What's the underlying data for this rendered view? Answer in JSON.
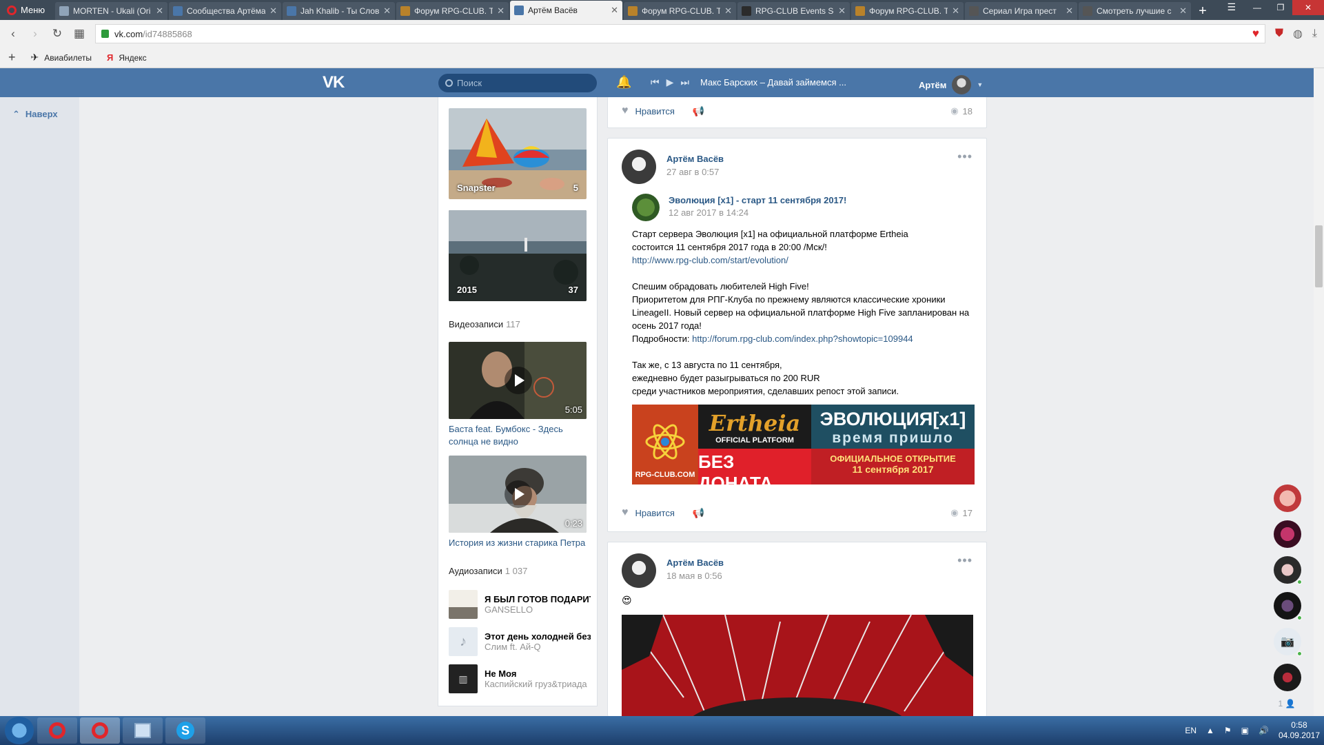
{
  "browser": {
    "menu_label": "Меню",
    "tabs": [
      {
        "label": "MORTEN - Ukali (Ori",
        "icon": "tab-favicon",
        "active": false
      },
      {
        "label": "Сообщества Артёма",
        "icon": "vk-favicon",
        "active": false
      },
      {
        "label": "Jah Khalib - Ты Слов",
        "icon": "vk-favicon",
        "active": false
      },
      {
        "label": "Форум RPG-CLUB. Т",
        "icon": "rpg-favicon",
        "active": false
      },
      {
        "label": "Артём Васёв",
        "icon": "vk-favicon",
        "active": true
      },
      {
        "label": "Форум RPG-CLUB. Т",
        "icon": "rpg-favicon",
        "active": false
      },
      {
        "label": "RPG-CLUB Events Sc",
        "icon": "dark-favicon",
        "active": false
      },
      {
        "label": "Форум RPG-CLUB. Т",
        "icon": "rpg-favicon",
        "active": false
      },
      {
        "label": "Сериал Игра прест",
        "icon": "film-favicon",
        "active": false
      },
      {
        "label": "Смотреть лучшие с",
        "icon": "film-favicon",
        "active": false
      }
    ],
    "url_host": "vk.com",
    "url_path": "/id74885868",
    "bookmarks": [
      {
        "label": "Авиабилеты",
        "icon": "plane-icon"
      },
      {
        "label": "Яндекс",
        "icon": "yandex-icon"
      }
    ]
  },
  "vk": {
    "search_placeholder": "Поиск",
    "now_playing": "Макс Барских – Давай займемся ...",
    "user_name": "Артём",
    "back_to_top": "Наверх"
  },
  "sidebar": {
    "albums": [
      {
        "title": "Snapster",
        "count": "5"
      },
      {
        "title": "2015",
        "count": "37"
      }
    ],
    "videos_title": "Видеозаписи",
    "videos_count": "117",
    "videos": [
      {
        "title": "Баста feat. Бумбокс - Здесь солнца не видно",
        "duration": "5:05"
      },
      {
        "title": "История из жизни старика Петра",
        "duration": "0:23"
      }
    ],
    "audio_title": "Аудиозаписи",
    "audio_count": "1 037",
    "audio": [
      {
        "title": "Я БЫЛ ГОТОВ ПОДАРИТ...",
        "artist": "GANSELLO"
      },
      {
        "title": "Этот день холодней без...",
        "artist": "Слим ft. Ай-Q"
      },
      {
        "title": "Не Моя",
        "artist": "Каспийский груз&триада"
      }
    ]
  },
  "posts": [
    {
      "like_label": "Нравится",
      "views": "18"
    },
    {
      "author": "Артём Васёв",
      "date": "27 авг в 0:57",
      "repost_author": "Эволюция [x1] - старт 11 сентября 2017!",
      "repost_date": "12 авг 2017 в 14:24",
      "text_lines": [
        "Старт сервера Эволюция [x1] на официальной платформе Ertheia",
        "состоится 11 сентября 2017 года в 20:00 /Мск/!"
      ],
      "link1": "http://www.rpg-club.com/start/evolution/",
      "text2_lines": [
        "Спешим обрадовать любителей High Five!",
        "Приоритетом для РПГ-Клуба по прежнему являются классические хроники",
        "LineageII. Новый сервер на официальной платформе High Five запланирован на",
        "осень 2017 года!"
      ],
      "details_label": "Подробности:",
      "link2": "http://forum.rpg-club.com/index.php?showtopic=109944",
      "text3_lines": [
        "Так же, с 13 августа по 11 сентября,",
        "ежедневно будет разыгрываться по 200 RUR",
        "среди участников мероприятия, сделавших репост этой записи."
      ],
      "banner": {
        "left_caption": "RPG-CLUB.COM",
        "brand": "Ertheia",
        "platform": "OFFICIAL PLATFORM",
        "nodonate": "БЕЗ ДОНАТА",
        "title": "ЭВОЛЮЦИЯ[x1]",
        "subtitle": "время пришло",
        "opening": "ОФИЦИАЛЬНОЕ ОТКРЫТИЕ",
        "opening_date": "11 сентября 2017"
      },
      "like_label": "Нравится",
      "views": "17"
    },
    {
      "author": "Артём Васёв",
      "date": "18 мая в 0:56",
      "emoji": "😍"
    }
  ],
  "chat": {
    "online_count": "1"
  },
  "taskbar": {
    "lang": "EN",
    "time": "0:58",
    "date": "04.09.2017"
  },
  "colors": {
    "vk_blue": "#4a76a8",
    "link": "#2a5885",
    "page_bg": "#edeef0"
  }
}
